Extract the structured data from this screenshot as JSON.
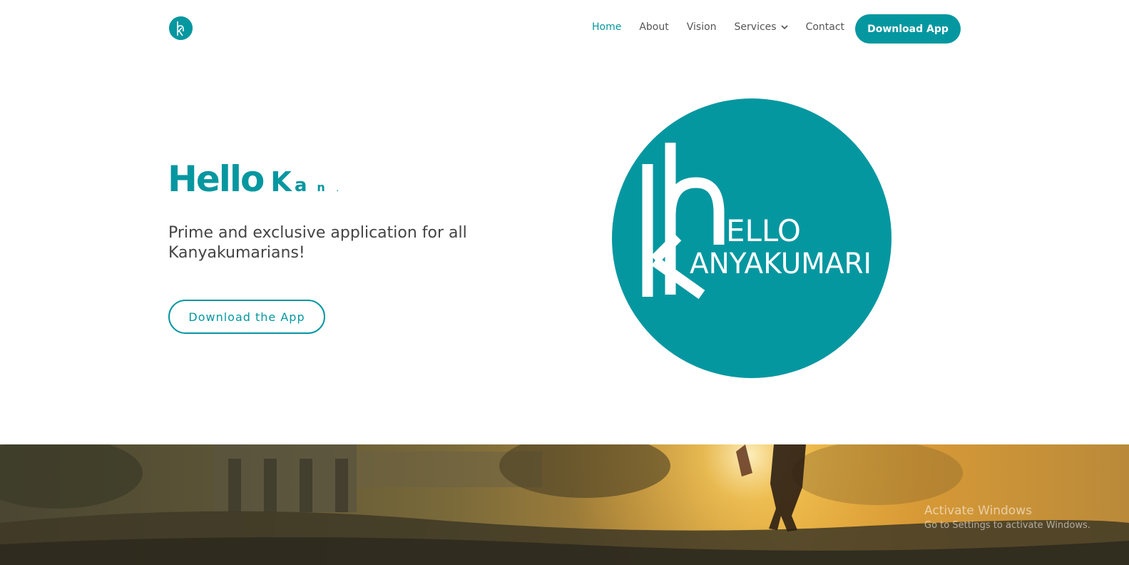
{
  "brand": {
    "name": "Hello Kanyakumari",
    "logo_icon": "hk-monogram-icon",
    "accent_color": "#0597a0",
    "logo_line1": "ELLO",
    "logo_line2": "ANYAKUMARI"
  },
  "nav": {
    "items": [
      {
        "label": "Home",
        "active": true
      },
      {
        "label": "About",
        "active": false
      },
      {
        "label": "Vision",
        "active": false
      },
      {
        "label": "Services",
        "active": false,
        "has_dropdown": true
      },
      {
        "label": "Contact",
        "active": false
      }
    ],
    "cta_label": "Download App"
  },
  "hero": {
    "title_static": "Hello",
    "title_animated": [
      "K",
      "a",
      "n",
      "."
    ],
    "subtitle": "Prime and exclusive application for all Kanyakumarians!",
    "button_label": "Download the App"
  },
  "watermark": {
    "line1": "Activate Windows",
    "line2": "Go to Settings to activate Windows."
  }
}
